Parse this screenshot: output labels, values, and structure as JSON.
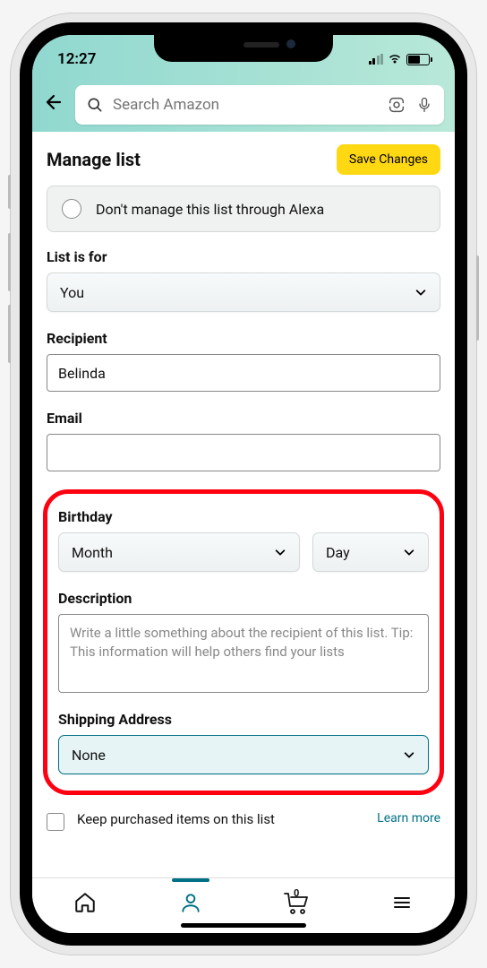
{
  "status": {
    "time": "12:27"
  },
  "search": {
    "placeholder": "Search Amazon"
  },
  "page": {
    "title": "Manage list",
    "save_button": "Save Changes"
  },
  "alexa": {
    "label": "Don't manage this list through Alexa"
  },
  "fields": {
    "list_for": {
      "label": "List is for",
      "value": "You"
    },
    "recipient": {
      "label": "Recipient",
      "value": "Belinda"
    },
    "email": {
      "label": "Email",
      "value": ""
    },
    "birthday": {
      "label": "Birthday",
      "month": "Month",
      "day": "Day"
    },
    "description": {
      "label": "Description",
      "placeholder": "Write a little something about the recipient of this list. Tip: This information will help others find your lists"
    },
    "shipping": {
      "label": "Shipping Address",
      "value": "None"
    },
    "keep": {
      "label": "Keep purchased items on this list",
      "learn_more": "Learn more"
    }
  },
  "nav": {
    "cart_count": "0"
  }
}
